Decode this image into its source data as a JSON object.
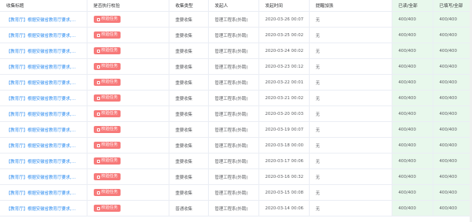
{
  "headers": [
    "收集标题",
    "是否执行校验",
    "收集类型",
    "发起人",
    "发起时间",
    "提醒加强",
    "已读/全部",
    "已填写/全部"
  ],
  "button_label": "校验任务",
  "rows": [
    {
      "title": "【教育厅】根据安徽省教育厅要求,…",
      "type": "重要收集",
      "sender": "管理工程系(外聘)",
      "time": "2020-03-26 00:07",
      "remind": "无",
      "read": "400/400",
      "filled": "400/400"
    },
    {
      "title": "【教育厅】根据安徽省教育厅要求,…",
      "type": "重要收集",
      "sender": "管理工程系(外聘)",
      "time": "2020-03-25 00:02",
      "remind": "无",
      "read": "400/400",
      "filled": "400/400"
    },
    {
      "title": "【教育厅】根据安徽省教育厅要求,…",
      "type": "重要收集",
      "sender": "管理工程系(外聘)",
      "time": "2020-03-24 00:02",
      "remind": "无",
      "read": "400/400",
      "filled": "400/400"
    },
    {
      "title": "【教育厅】根据安徽省教育厅要求,…",
      "type": "重要收集",
      "sender": "管理工程系(外聘)",
      "time": "2020-03-23 00:12",
      "remind": "无",
      "read": "400/400",
      "filled": "400/400"
    },
    {
      "title": "【教育厅】根据安徽省教育厅要求,…",
      "type": "重要收集",
      "sender": "管理工程系(外聘)",
      "time": "2020-03-22 00:01",
      "remind": "无",
      "read": "400/400",
      "filled": "400/400"
    },
    {
      "title": "【教育厅】根据安徽省教育厅要求,…",
      "type": "重要收集",
      "sender": "管理工程系(外聘)",
      "time": "2020-03-21 00:02",
      "remind": "无",
      "read": "400/400",
      "filled": "400/400"
    },
    {
      "title": "【教育厅】根据安徽省教育厅要求,…",
      "type": "重要收集",
      "sender": "管理工程系(外聘)",
      "time": "2020-03-20 00:03",
      "remind": "无",
      "read": "400/400",
      "filled": "400/400"
    },
    {
      "title": "【教育厅】根据安徽省教育厅要求,…",
      "type": "重要收集",
      "sender": "管理工程系(外聘)",
      "time": "2020-03-19 00:07",
      "remind": "无",
      "read": "400/400",
      "filled": "400/400"
    },
    {
      "title": "【教育厅】根据安徽省教育厅要求,…",
      "type": "重要收集",
      "sender": "管理工程系(外聘)",
      "time": "2020-03-18 00:00",
      "remind": "无",
      "read": "400/400",
      "filled": "400/400"
    },
    {
      "title": "【教育厅】根据安徽省教育厅要求,…",
      "type": "重要收集",
      "sender": "管理工程系(外聘)",
      "time": "2020-03-17 00:06",
      "remind": "无",
      "read": "400/400",
      "filled": "400/400"
    },
    {
      "title": "【教育厅】根据安徽省教育厅要求,…",
      "type": "重要收集",
      "sender": "管理工程系(外聘)",
      "time": "2020-03-16 00:32",
      "remind": "无",
      "read": "400/400",
      "filled": "400/400"
    },
    {
      "title": "【教育厅】根据安徽省教育厅要求,…",
      "type": "重要收集",
      "sender": "管理工程系(外聘)",
      "time": "2020-03-15 00:08",
      "remind": "无",
      "read": "400/400",
      "filled": "400/400"
    },
    {
      "title": "【教育厅】根据安徽省教育厅要求,…",
      "type": "普通收集",
      "sender": "管理工程系(外聘)",
      "time": "2020-03-14 00:06",
      "remind": "无",
      "read": "400/400",
      "filled": "400/400"
    }
  ],
  "colors": {
    "button": "#f77a7a",
    "link": "#2d8cf0",
    "highlight": "#e8f8ec"
  }
}
